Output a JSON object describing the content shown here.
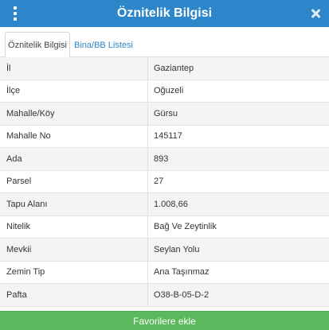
{
  "header": {
    "title": "Öznitelik Bilgisi"
  },
  "tabs": [
    {
      "label": "Öznitelik Bilgisi",
      "active": true
    },
    {
      "label": "Bina/BB Listesi",
      "active": false
    }
  ],
  "attributes": [
    {
      "label": "İl",
      "value": "Gaziantep"
    },
    {
      "label": "İlçe",
      "value": "Oğuzeli"
    },
    {
      "label": "Mahalle/Köy",
      "value": "Gürsu"
    },
    {
      "label": "Mahalle No",
      "value": "145117"
    },
    {
      "label": "Ada",
      "value": "893"
    },
    {
      "label": "Parsel",
      "value": "27"
    },
    {
      "label": "Tapu Alanı",
      "value": "1.008,66"
    },
    {
      "label": "Nitelik",
      "value": "Bağ Ve Zeytinlik"
    },
    {
      "label": "Mevkii",
      "value": "Seylan Yolu"
    },
    {
      "label": "Zemin Tip",
      "value": "Ana Taşınmaz"
    },
    {
      "label": "Pafta",
      "value": "O38-B-05-D-2"
    }
  ],
  "actions": {
    "favorite_label": "Favorilere ekle"
  },
  "colors": {
    "header": "#2d86c9",
    "button": "#5cb85c"
  }
}
